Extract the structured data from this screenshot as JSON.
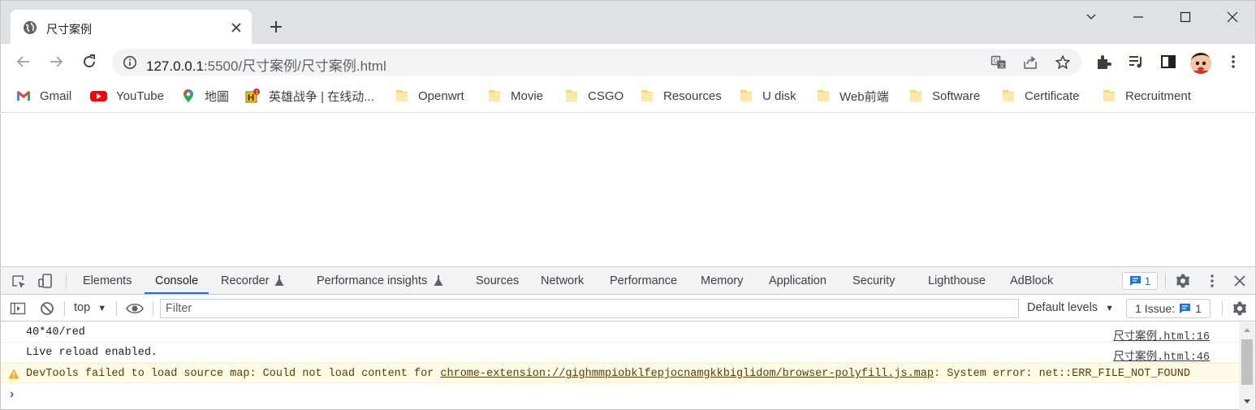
{
  "browser": {
    "tab": {
      "title": "尺寸案例",
      "favicon": "globe-icon"
    },
    "window_controls": [
      "chevron-down-icon",
      "minimize-icon",
      "maximize-icon",
      "close-icon"
    ],
    "address": {
      "host": "127.0.0.1",
      "path": ":5500/尺寸案例/尺寸案例.html"
    },
    "toolbar_icons": [
      "translate-icon",
      "share-icon",
      "star-icon",
      "extensions-icon",
      "reading-list-icon",
      "side-panel-icon",
      "avatar",
      "more-icon"
    ]
  },
  "bookmarks": [
    {
      "label": "Gmail",
      "icon": "gmail-icon"
    },
    {
      "label": "YouTube",
      "icon": "youtube-icon"
    },
    {
      "label": "地圖",
      "icon": "maps-icon"
    },
    {
      "label": "英雄战争 | 在线动...",
      "icon": "game-icon"
    },
    {
      "label": "Openwrt",
      "icon": "folder-icon"
    },
    {
      "label": "Movie",
      "icon": "folder-icon"
    },
    {
      "label": "CSGO",
      "icon": "folder-icon"
    },
    {
      "label": "Resources",
      "icon": "folder-icon"
    },
    {
      "label": "U disk",
      "icon": "folder-icon"
    },
    {
      "label": "Web前端",
      "icon": "folder-icon"
    },
    {
      "label": "Software",
      "icon": "folder-icon"
    },
    {
      "label": "Certificate",
      "icon": "folder-icon"
    },
    {
      "label": "Recruitment",
      "icon": "folder-icon"
    }
  ],
  "devtools": {
    "tabs": [
      "Elements",
      "Console",
      "Recorder",
      "Performance insights",
      "Sources",
      "Network",
      "Performance",
      "Memory",
      "Application",
      "Security",
      "Lighthouse",
      "AdBlock"
    ],
    "active_tab": "Console",
    "issues_badge": "1",
    "context": "top",
    "filter_placeholder": "Filter",
    "levels": "Default levels",
    "issue_count": "1 Issue:",
    "issue_count_num": "1",
    "messages": [
      {
        "text": "40*40/red",
        "source": "尺寸案例.html:16",
        "level": "log"
      },
      {
        "text": "Live reload enabled.",
        "source": "尺寸案例.html:46",
        "level": "log"
      },
      {
        "level": "warning",
        "prefix": "DevTools failed to load source map: Could not load content for ",
        "link": "chrome-extension://gighmmpiobklfepjocnamgkkbiglidom/browser-polyfill.js.map",
        "suffix": ": System error: net::ERR_FILE_NOT_FOUND"
      }
    ],
    "prompt": "›"
  },
  "colors": {
    "accent": "#1a73e8",
    "warning_bg": "#fffbe5",
    "tabstrip": "#dee1e6"
  }
}
